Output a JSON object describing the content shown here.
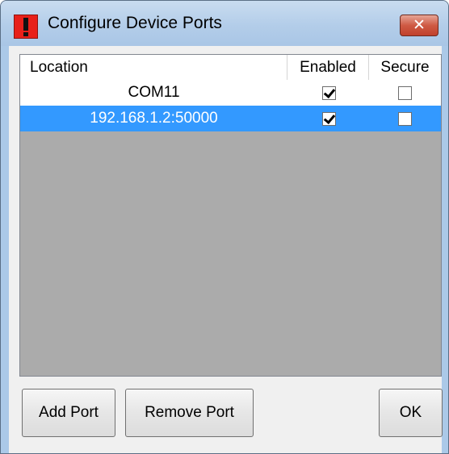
{
  "window": {
    "title": "Configure Device Ports",
    "close_glyph": "✕",
    "app_icon": "exclamation-app-icon"
  },
  "list": {
    "columns": [
      "Location",
      "Enabled",
      "Secure"
    ],
    "rows": [
      {
        "location": "COM11",
        "enabled": true,
        "secure": false,
        "selected": false
      },
      {
        "location": "192.168.1.2:50000",
        "enabled": true,
        "secure": false,
        "selected": true
      }
    ]
  },
  "buttons": {
    "add_port": "Add Port",
    "remove_port": "Remove Port",
    "ok": "OK"
  },
  "colors": {
    "selection": "#3399ff",
    "list_empty_area": "#ababab",
    "app_icon": "#e8201a"
  }
}
